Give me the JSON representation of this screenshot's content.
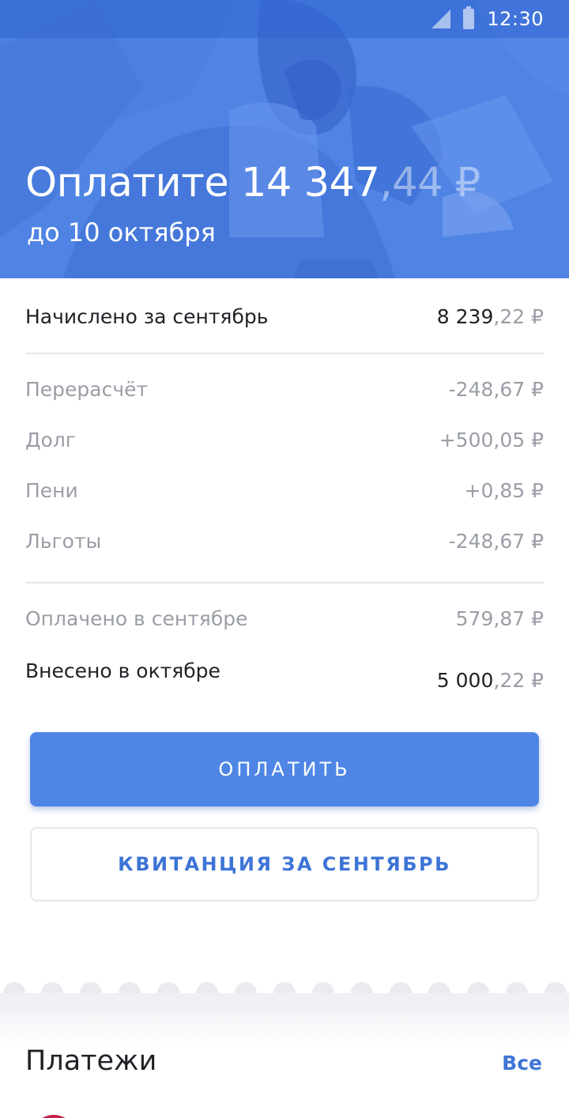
{
  "status_bar": {
    "time": "12:30"
  },
  "hero": {
    "title_prefix": "Оплатите 14 347",
    "title_cents": ",44 ₽",
    "subtitle": "до 10 октября"
  },
  "summary": {
    "accrued": {
      "label": "Начислено за сентябрь",
      "value_main": "8 239",
      "value_cents": ",22 ₽"
    },
    "adjustments": [
      {
        "label": "Перерасчёт",
        "value": "-248,67 ₽"
      },
      {
        "label": "Долг",
        "value": "+500,05 ₽"
      },
      {
        "label": "Пени",
        "value": "+0,85 ₽"
      },
      {
        "label": "Льготы",
        "value": "-248,67 ₽"
      }
    ],
    "paid": {
      "label": "Оплачено в сентябре",
      "value": "579,87 ₽"
    },
    "deposited": {
      "label": "Внесено в октябре",
      "value_main": "5 000",
      "value_cents": ",22 ₽"
    }
  },
  "actions": {
    "pay_label": "ОПЛАТИТЬ",
    "receipt_label": "КВИТАНЦИЯ ЗА СЕНТЯБРЬ"
  },
  "payments": {
    "title": "Платежи",
    "all_link": "Все"
  },
  "colors": {
    "accent": "#4f86e6",
    "link": "#3d74d6",
    "hero_bg": "#4f84e4",
    "muted_text": "#9a9ea6"
  }
}
